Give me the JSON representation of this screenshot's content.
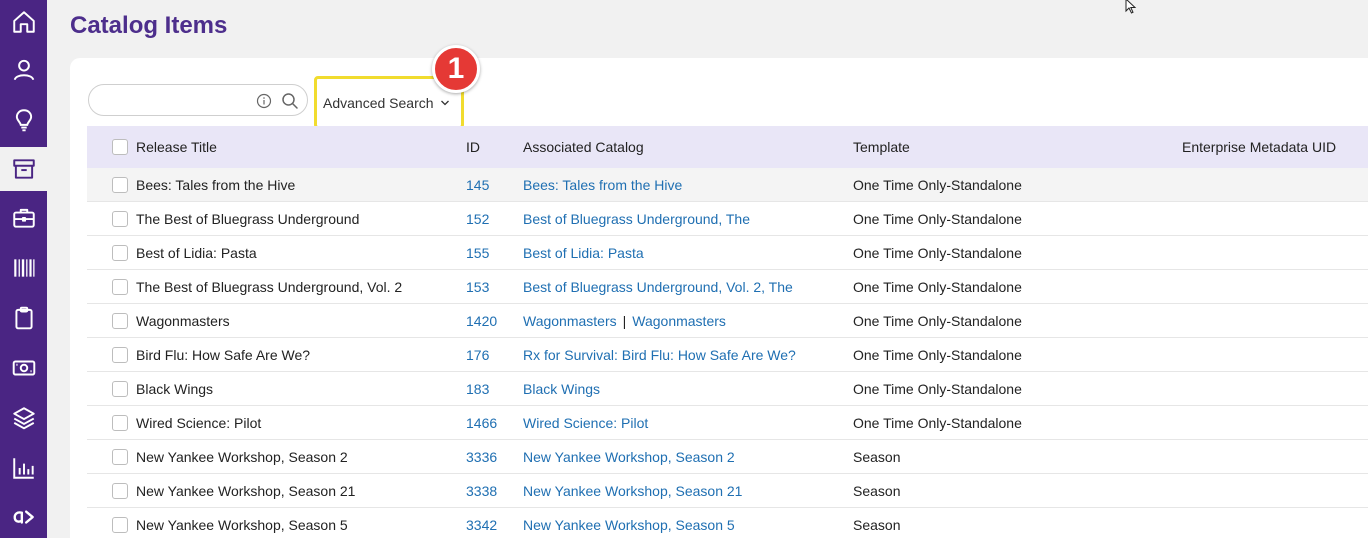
{
  "page": {
    "title": "Catalog Items"
  },
  "sidebar": {
    "items": [
      {
        "icon": "home-icon"
      },
      {
        "icon": "user-icon"
      },
      {
        "icon": "lightbulb-icon"
      },
      {
        "icon": "archive-box-icon",
        "active": true
      },
      {
        "icon": "briefcase-icon"
      },
      {
        "icon": "barcode-icon"
      },
      {
        "icon": "clipboard-icon"
      },
      {
        "icon": "money-icon"
      },
      {
        "icon": "layers-icon"
      },
      {
        "icon": "bar-chart-icon"
      },
      {
        "icon": "brand-logo-icon"
      }
    ]
  },
  "search": {
    "value": "",
    "placeholder": ""
  },
  "advanced_search": {
    "label": "Advanced Search"
  },
  "callout": {
    "number": "1",
    "color": "#e53935",
    "highlight_color": "#f1dc2e"
  },
  "table": {
    "headers": {
      "title": "Release Title",
      "id": "ID",
      "catalog": "Associated Catalog",
      "template": "Template",
      "uid": "Enterprise Metadata UID"
    },
    "rows": [
      {
        "title": "Bees: Tales from the Hive",
        "id": "145",
        "catalog": [
          "Bees: Tales from the Hive"
        ],
        "template": "One Time Only-Standalone",
        "uid": ""
      },
      {
        "title": "The Best of Bluegrass Underground",
        "id": "152",
        "catalog": [
          "Best of Bluegrass Underground, The"
        ],
        "template": "One Time Only-Standalone",
        "uid": ""
      },
      {
        "title": "Best of Lidia: Pasta",
        "id": "155",
        "catalog": [
          "Best of Lidia: Pasta"
        ],
        "template": "One Time Only-Standalone",
        "uid": ""
      },
      {
        "title": "The Best of Bluegrass Underground, Vol. 2",
        "id": "153",
        "catalog": [
          "Best of Bluegrass Underground, Vol. 2, The"
        ],
        "template": "One Time Only-Standalone",
        "uid": ""
      },
      {
        "title": "Wagonmasters",
        "id": "1420",
        "catalog": [
          "Wagonmasters",
          "Wagonmasters"
        ],
        "template": "One Time Only-Standalone",
        "uid": ""
      },
      {
        "title": "Bird Flu: How Safe Are We?",
        "id": "176",
        "catalog": [
          "Rx for Survival: Bird Flu: How Safe Are We?"
        ],
        "template": "One Time Only-Standalone",
        "uid": ""
      },
      {
        "title": "Black Wings",
        "id": "183",
        "catalog": [
          "Black Wings"
        ],
        "template": "One Time Only-Standalone",
        "uid": ""
      },
      {
        "title": "Wired Science: Pilot",
        "id": "1466",
        "catalog": [
          "Wired Science: Pilot"
        ],
        "template": "One Time Only-Standalone",
        "uid": ""
      },
      {
        "title": "New Yankee Workshop, Season 2",
        "id": "3336",
        "catalog": [
          "New Yankee Workshop, Season 2"
        ],
        "template": "Season",
        "uid": ""
      },
      {
        "title": "New Yankee Workshop, Season 21",
        "id": "3338",
        "catalog": [
          "New Yankee Workshop, Season 21"
        ],
        "template": "Season",
        "uid": ""
      },
      {
        "title": "New Yankee Workshop, Season 5",
        "id": "3342",
        "catalog": [
          "New Yankee Workshop, Season 5"
        ],
        "template": "Season",
        "uid": ""
      }
    ]
  },
  "colors": {
    "sidebar": "#4a2583",
    "title": "#4d2e8c",
    "header_bg": "#e9e6f7",
    "link": "#1f6fb2"
  }
}
